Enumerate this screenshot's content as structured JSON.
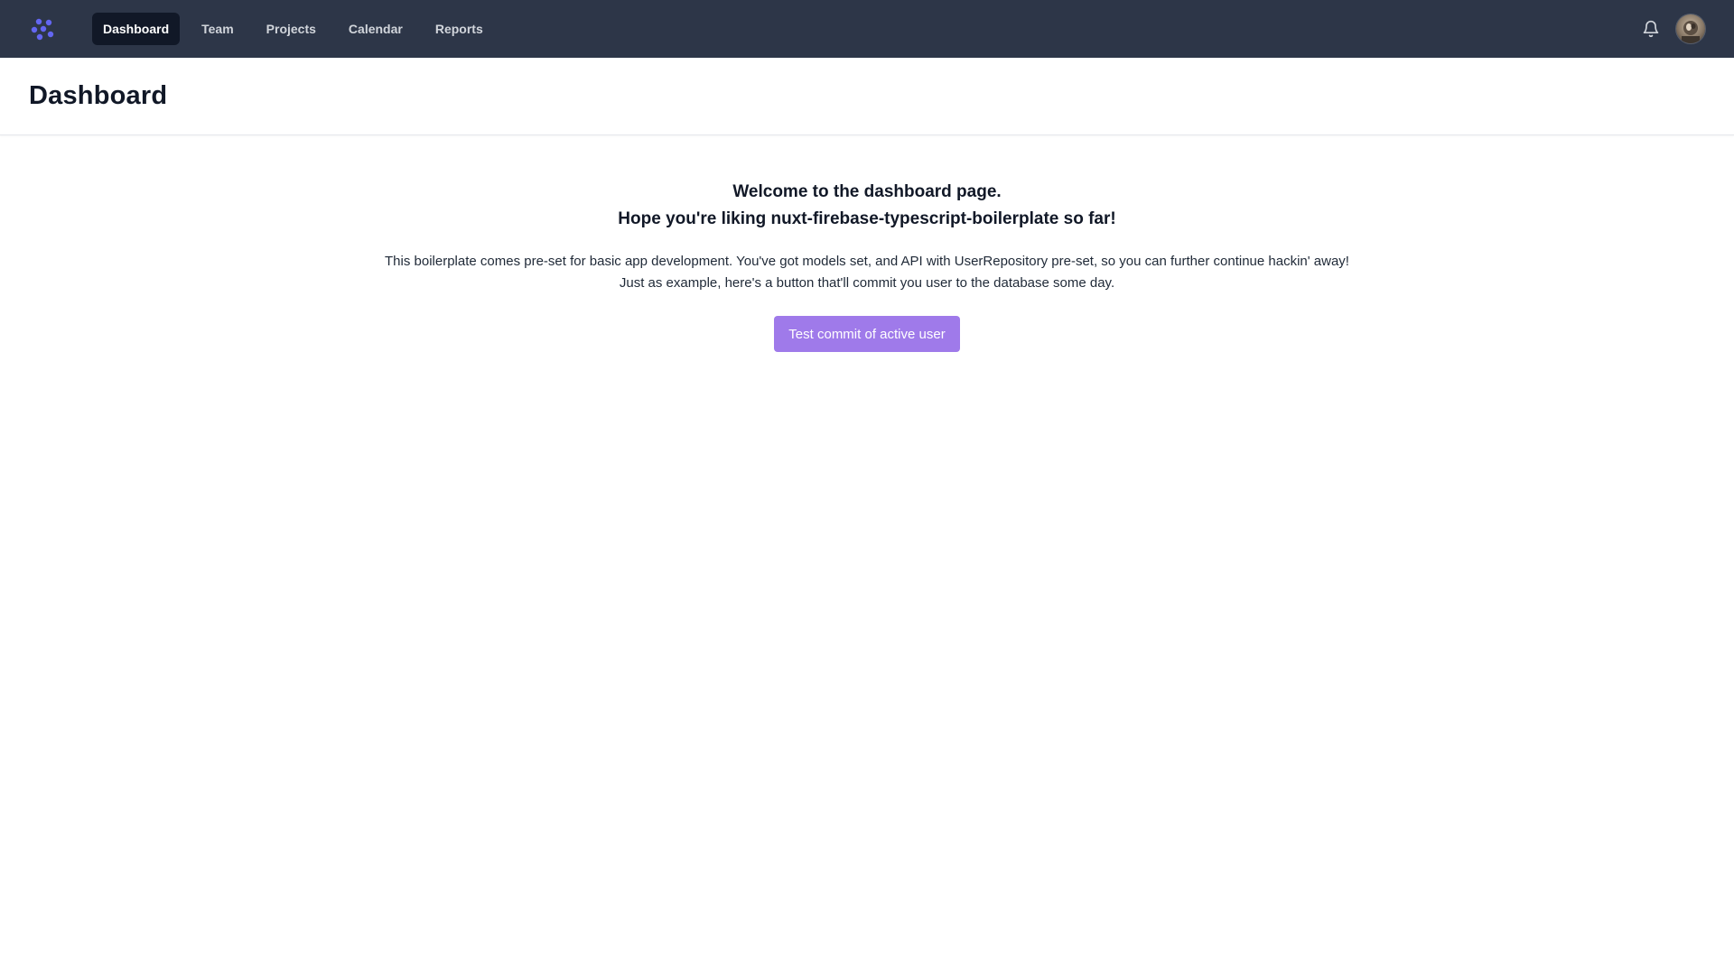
{
  "nav": {
    "logo_icon": "pinwheel-logo-icon",
    "items": [
      {
        "label": "Dashboard",
        "active": true
      },
      {
        "label": "Team",
        "active": false
      },
      {
        "label": "Projects",
        "active": false
      },
      {
        "label": "Calendar",
        "active": false
      },
      {
        "label": "Reports",
        "active": false
      }
    ],
    "bell_icon": "bell-icon",
    "avatar_icon": "user-avatar"
  },
  "header": {
    "title": "Dashboard"
  },
  "main": {
    "welcome_line1": "Welcome to the dashboard page.",
    "welcome_line2": "Hope you're liking nuxt-firebase-typescript-boilerplate so far!",
    "desc_line1": "This boilerplate comes pre-set for basic app development. You've got models set, and API with UserRepository pre-set, so you can further continue hackin' away!",
    "desc_line2": "Just as example, here's a button that'll commit you user to the database some day.",
    "button_label": "Test commit of active user"
  },
  "colors": {
    "navbar_bg": "#2d3648",
    "nav_active_bg": "#111827",
    "logo_accent": "#6366f1",
    "button_bg": "#9f7aea"
  }
}
